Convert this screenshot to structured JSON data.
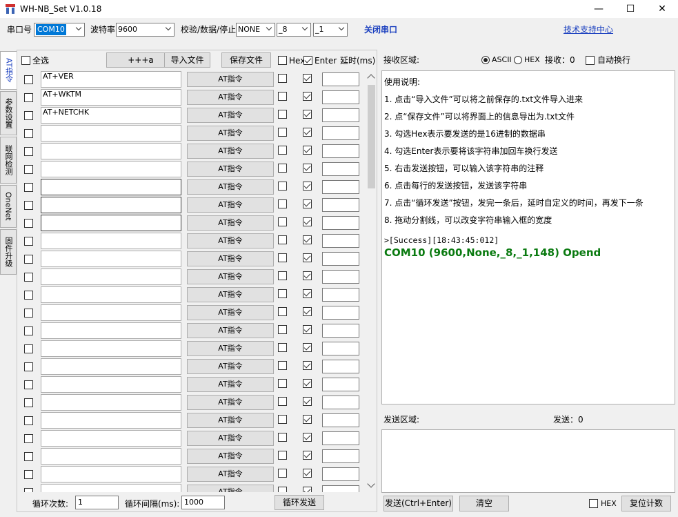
{
  "window": {
    "title": "WH-NB_Set V1.0.18",
    "minimize": "—",
    "maximize": "☐",
    "close": "✕"
  },
  "toolbar": {
    "port_label": "串口号",
    "port_value": "COM10",
    "baud_label": "波特率",
    "baud_value": "9600",
    "parity_label": "校验/数据/停止",
    "parity_value": "NONE",
    "databits_value": "_8",
    "stopbits_value": "_1",
    "close_port": "关闭串口",
    "support_link": "技术支持中心"
  },
  "tabs": [
    "AT指令",
    "参数设置",
    "联网检测",
    "OneNet",
    "固件升级"
  ],
  "left_header": {
    "select_all": "全选",
    "plus_btn": "+++a",
    "import_btn": "导入文件",
    "save_btn": "保存文件",
    "hex": "Hex",
    "enter": "Enter",
    "delay": "延时(ms)"
  },
  "at_button_label": "AT指令",
  "commands": [
    "AT+VER",
    "AT+WKTM",
    "AT+NETCHK",
    "",
    "",
    "",
    "",
    "",
    "",
    "",
    "",
    "",
    "",
    "",
    "",
    "",
    "",
    "",
    "",
    "",
    "",
    "",
    "",
    ""
  ],
  "footer": {
    "loop_count_label": "循环次数:",
    "loop_count_value": "1",
    "loop_interval_label": "循环间隔(ms):",
    "loop_interval_value": "1000",
    "loop_send_btn": "循环发送"
  },
  "receive": {
    "label": "接收区域:",
    "ascii": "ASCII",
    "hex": "HEX",
    "count": "接收：0",
    "auto_wrap": "自动换行",
    "lines": [
      "使用说明:",
      "1. 点击“导入文件”可以将之前保存的.txt文件导入进来",
      "2. 点“保存文件”可以将界面上的信息导出为.txt文件",
      "3. 勾选Hex表示要发送的是16进制的数据串",
      "4. 勾选Enter表示要将该字符串加回车换行发送",
      "5. 右击发送按钮，可以输入该字符串的注释",
      "6. 点击每行的发送按钮，发送该字符串",
      "7. 点击“循环发送”按钮，发完一条后，延时自定义的时间，再发下一条",
      "8. 拖动分割线，可以改变字符串输入框的宽度"
    ],
    "success_line": ">[Success][18:43:45:012]",
    "open_line": "COM10 (9600,None,_8,_1,148) Opend"
  },
  "send": {
    "label": "发送区域:",
    "count": "发送：0",
    "send_btn": "发送(Ctrl+Enter)",
    "clear_btn": "清空",
    "hex": "HEX",
    "reset_btn": "复位计数"
  }
}
